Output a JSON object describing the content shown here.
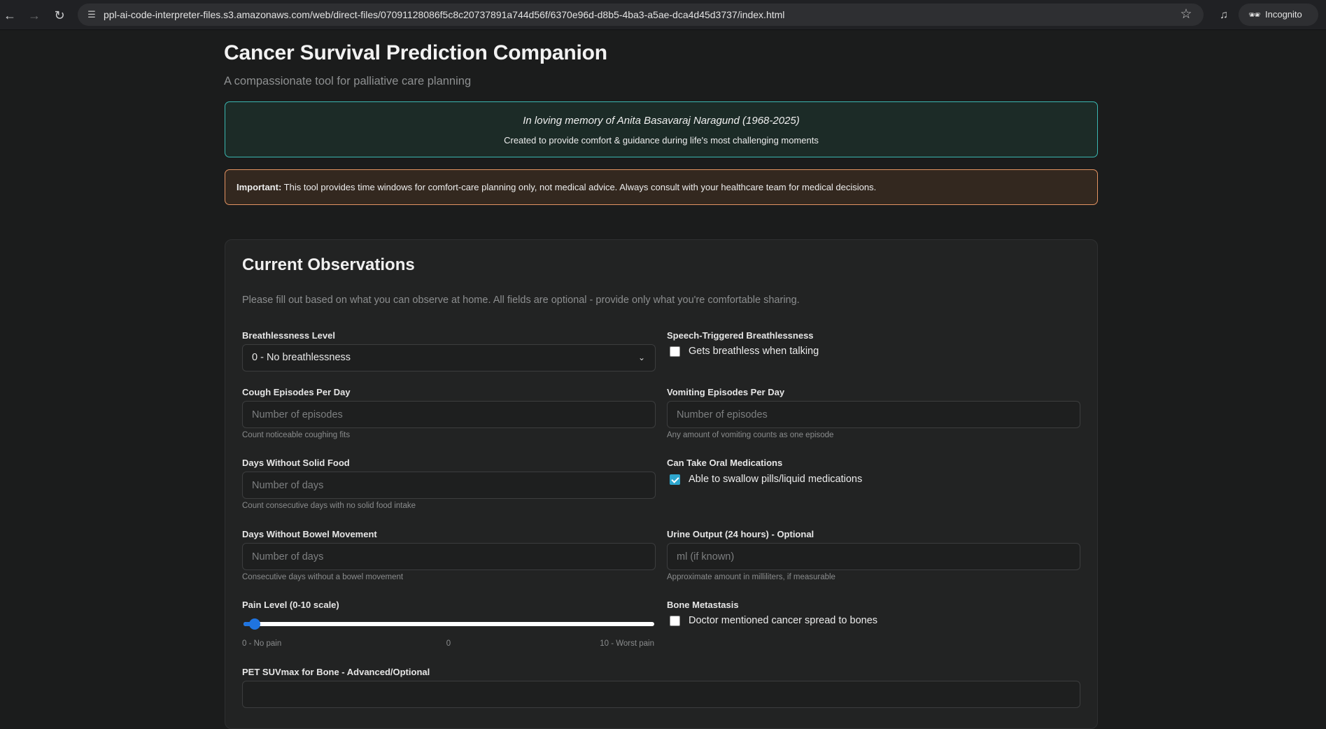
{
  "browser": {
    "url": "ppl-ai-code-interpreter-files.s3.amazonaws.com/web/direct-files/07091128086f5c8c20737891a744d56f/6370e96d-d8b5-4ba3-a5ae-dca4d45d3737/index.html",
    "profile_label": "Incognito",
    "icons": {
      "back": "arrow-left-icon",
      "forward": "arrow-right-icon",
      "reload": "reload-icon",
      "site_info": "tune-icon",
      "bookmark": "star-icon",
      "media": "media-control-icon",
      "incognito": "incognito-icon"
    }
  },
  "header": {
    "title": "Cancer Survival Prediction Companion",
    "subtitle": "A compassionate tool for palliative care planning"
  },
  "memorial": {
    "line1": "In loving memory of Anita Basavaraj Naragund (1968-2025)",
    "line2": "Created to provide comfort & guidance during life's most challenging moments",
    "border_color": "#3ab7b1"
  },
  "notice": {
    "label": "Important:",
    "text": " This tool provides time windows for comfort-care planning only, not medical advice. Always consult with your healthcare team for medical decisions.",
    "border_color": "#e39362"
  },
  "observations": {
    "title": "Current Observations",
    "description": "Please fill out based on what you can observe at home. All fields are optional - provide only what you're comfortable sharing.",
    "breathlessness": {
      "label": "Breathlessness Level",
      "selected": "0 - No breathlessness"
    },
    "speech_breathlessness": {
      "label": "Speech-Triggered Breathlessness",
      "option": "Gets breathless when talking",
      "checked": false
    },
    "cough": {
      "label": "Cough Episodes Per Day",
      "placeholder": "Number of episodes",
      "value": "",
      "hint": "Count noticeable coughing fits"
    },
    "vomiting": {
      "label": "Vomiting Episodes Per Day",
      "placeholder": "Number of episodes",
      "value": "",
      "hint": "Any amount of vomiting counts as one episode"
    },
    "solid_food": {
      "label": "Days Without Solid Food",
      "placeholder": "Number of days",
      "value": "",
      "hint": "Count consecutive days with no solid food intake"
    },
    "oral_meds": {
      "label": "Can Take Oral Medications",
      "option": "Able to swallow pills/liquid medications",
      "checked": true
    },
    "bowel": {
      "label": "Days Without Bowel Movement",
      "placeholder": "Number of days",
      "value": "",
      "hint": "Consecutive days without a bowel movement"
    },
    "urine": {
      "label": "Urine Output (24 hours) - Optional",
      "placeholder": "ml (if known)",
      "value": "",
      "hint": "Approximate amount in milliliters, if measurable"
    },
    "pain": {
      "label": "Pain Level (0-10 scale)",
      "min": 0,
      "max": 10,
      "value": 0,
      "value_label": "0",
      "min_label": "0 - No pain",
      "max_label": "10 - Worst pain"
    },
    "bone_mets": {
      "label": "Bone Metastasis",
      "option": "Doctor mentioned cancer spread to bones",
      "checked": false
    },
    "pet_suv": {
      "label": "PET SUVmax for Bone - Advanced/Optional"
    }
  },
  "colors": {
    "accent_blue": "#1f74e0",
    "checkbox_checked": "#2ea7cf"
  }
}
